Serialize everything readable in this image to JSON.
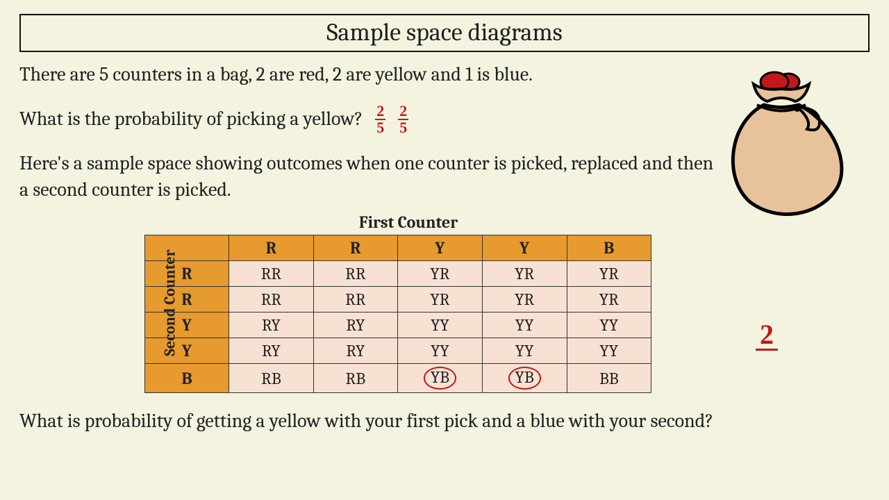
{
  "title": "Sample space diagrams",
  "intro": "There are 5 counters in a bag, 2 are red, 2 are yellow and 1 is blue.",
  "q_yellow_label": "What is the probability of picking a yellow?",
  "answer_fraction_1": {
    "num": "2",
    "den": "5"
  },
  "answer_fraction_2": {
    "num": "2",
    "den": "5"
  },
  "sample_space_intro": "Here's a sample space showing outcomes when one counter is picked, replaced and then a second counter is picked.",
  "table": {
    "top_caption": "First Counter",
    "side_caption": "Second Counter",
    "col_headers": [
      "R",
      "R",
      "Y",
      "Y",
      "B"
    ],
    "row_headers": [
      "R",
      "R",
      "Y",
      "Y",
      "B"
    ],
    "cells": [
      [
        "RR",
        "RR",
        "YR",
        "YR",
        "YR"
      ],
      [
        "RR",
        "RR",
        "YR",
        "YR",
        "YR"
      ],
      [
        "RY",
        "RY",
        "YY",
        "YY",
        "YY"
      ],
      [
        "RY",
        "RY",
        "YY",
        "YY",
        "YY"
      ],
      [
        "RB",
        "RB",
        "YB",
        "YB",
        "BB"
      ]
    ],
    "circled_cells": [
      [
        4,
        2
      ],
      [
        4,
        3
      ]
    ]
  },
  "handwritten_count": "2",
  "final_question": "What is probability of getting a yellow with your first pick and a blue with your second?",
  "colors": {
    "handwriting": "#c21818",
    "header_fill": "#e79a2d",
    "cell_fill": "#f6e1d3",
    "page_bg": "#f3f3e0"
  }
}
